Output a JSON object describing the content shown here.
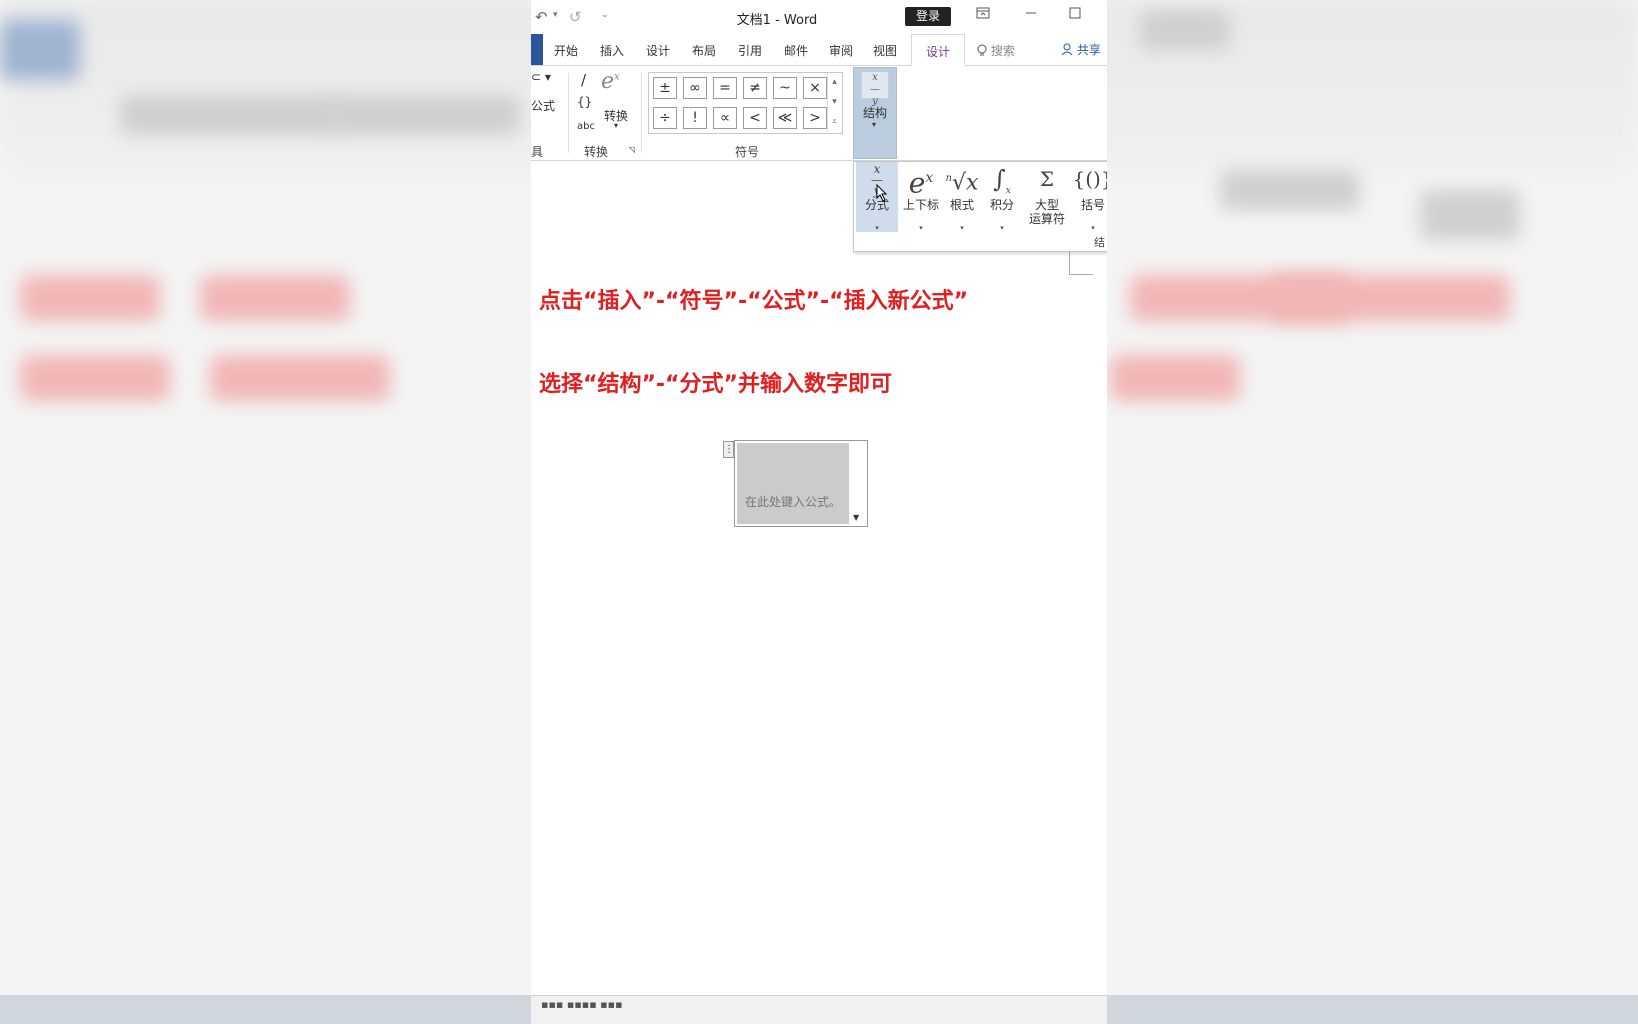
{
  "window": {
    "title": "文档1  -  Word",
    "login_label": "登录"
  },
  "quick_access": {
    "undo_glyph": "↶",
    "redo_glyph": "↺",
    "customize_glyph": "⌄"
  },
  "tabs": [
    {
      "label": "开始"
    },
    {
      "label": "插入"
    },
    {
      "label": "设计"
    },
    {
      "label": "布局"
    },
    {
      "label": "引用"
    },
    {
      "label": "邮件"
    },
    {
      "label": "审阅"
    },
    {
      "label": "视图"
    },
    {
      "label": "设计",
      "active": true
    }
  ],
  "search": {
    "label": "搜索",
    "icon": "lightbulb-icon"
  },
  "share": {
    "label": "共享",
    "icon": "person-icon"
  },
  "ribbon": {
    "formula_label": "公式",
    "tools_group_label": "具",
    "convert_group": {
      "label": "转换",
      "button_label": "转换",
      "abc_label": "abc"
    },
    "symbols_group": {
      "label": "符号",
      "row1": [
        "±",
        "∞",
        "=",
        "≠",
        "~",
        "×"
      ],
      "row2": [
        "÷",
        "!",
        "∝",
        "<",
        "≪",
        ">"
      ]
    },
    "structure_button": {
      "label": "结构",
      "icon": "fraction-icon"
    }
  },
  "structure_dropdown": {
    "items": [
      {
        "label": "分式",
        "icon": "fraction-icon",
        "glyph": "x/y"
      },
      {
        "label": "上下标",
        "icon": "superscript-icon",
        "glyph": "eˣ"
      },
      {
        "label": "根式",
        "icon": "radical-icon",
        "glyph": "ⁿ√x"
      },
      {
        "label": "积分",
        "icon": "integral-icon",
        "glyph": "∫"
      },
      {
        "label": "大型\n运算符",
        "icon": "large-operator-icon",
        "glyph": "Σ"
      },
      {
        "label": "括号",
        "icon": "bracket-icon",
        "glyph": "{()}"
      }
    ],
    "footer_label": "结"
  },
  "document": {
    "instruction_1": "点击“插入”-“符号”-“公式”-“插入新公式”",
    "instruction_2": "选择“结构”-“分式”并输入数字即可",
    "equation_placeholder": "在此处键入公式。"
  },
  "colors": {
    "accent_red": "#e02020",
    "word_blue": "#2b579a",
    "structure_active": "#bcccdf"
  }
}
